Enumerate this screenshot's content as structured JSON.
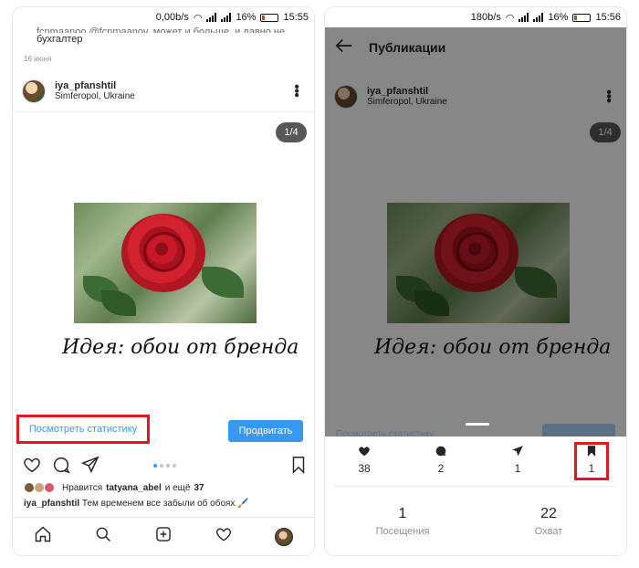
{
  "left": {
    "status": {
      "speed": "0,00b/s",
      "battery": "16%",
      "time": "15:55"
    },
    "prev_caption_cut": "fcnmaanoo @fcnmaanov, может и больше, и давно не",
    "prev_caption_line": "бухгалтер",
    "prev_date": "16 июня",
    "post": {
      "username": "iya_pfanshtil",
      "location": "Simferopol, Ukraine",
      "counter": "1/4",
      "idea_text": "Идея: обои от бренда"
    },
    "view_stats": "Посмотреть статистику",
    "promote": "Продвигать",
    "likes_prefix": "Нравится",
    "likes_user": "tatyana_abel",
    "likes_mid": "и ещё",
    "likes_count": "37",
    "caption_user": "iya_pfanshtil",
    "caption_text": "Тем временем все забыли об обоях 🖌️"
  },
  "right": {
    "status": {
      "speed": "180b/s",
      "battery": "16%",
      "time": "15:56"
    },
    "title": "Публикации",
    "post": {
      "username": "iya_pfanshtil",
      "location": "Simferopol, Ukraine",
      "counter": "1/4",
      "idea_text": "Идея: обои от бренда"
    },
    "behind_link": "Посмотреть статистику",
    "behind_btn": "Продвигать",
    "metrics": {
      "likes": "38",
      "comments": "2",
      "shares": "1",
      "saves": "1"
    },
    "visits": {
      "value": "1",
      "label": "Посещения"
    },
    "reach": {
      "value": "22",
      "label": "Охват"
    }
  },
  "colors": {
    "accent": "#3897f0",
    "highlight": "#e0191f"
  },
  "icons": [
    "back-arrow-icon",
    "more-options-icon",
    "heart-icon",
    "comment-icon",
    "share-icon",
    "bookmark-icon",
    "home-icon",
    "search-icon",
    "add-icon",
    "activity-icon"
  ]
}
